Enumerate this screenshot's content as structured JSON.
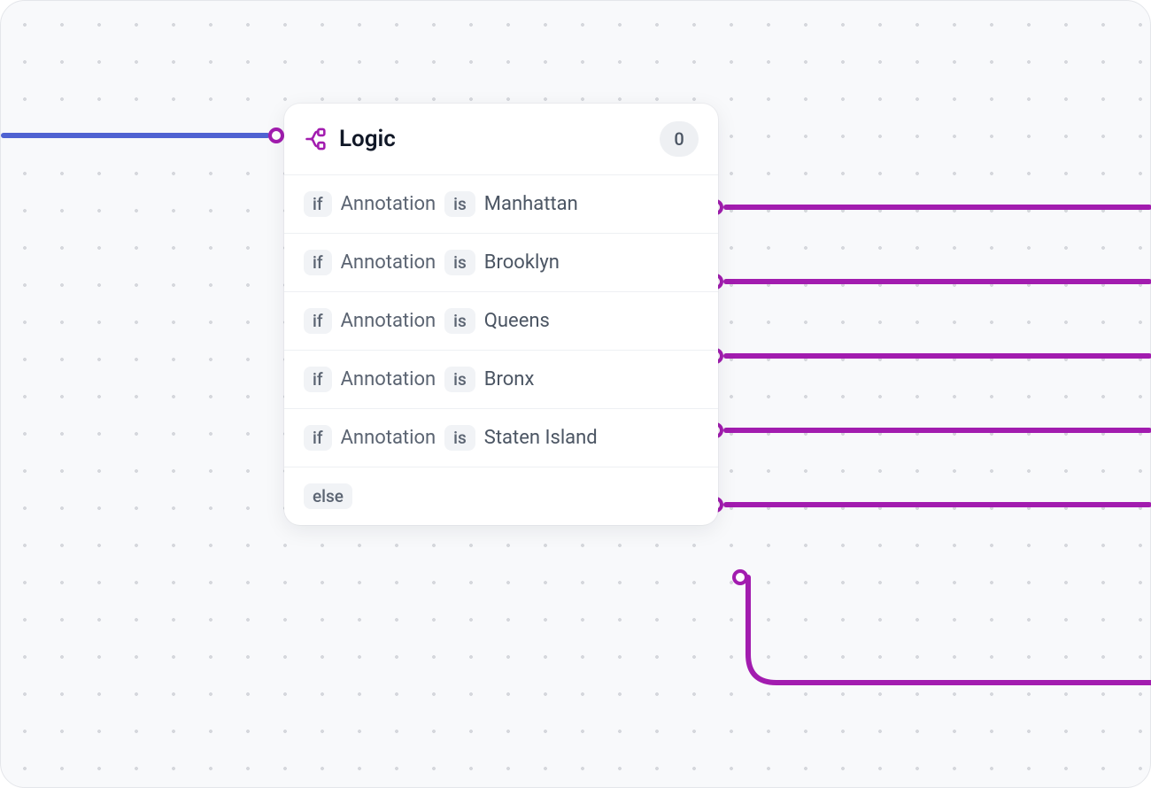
{
  "node": {
    "title": "Logic",
    "count": "0",
    "rules": [
      {
        "keyword": "if",
        "field": "Annotation",
        "op": "is",
        "value": "Manhattan"
      },
      {
        "keyword": "if",
        "field": "Annotation",
        "op": "is",
        "value": "Brooklyn"
      },
      {
        "keyword": "if",
        "field": "Annotation",
        "op": "is",
        "value": "Queens"
      },
      {
        "keyword": "if",
        "field": "Annotation",
        "op": "is",
        "value": "Bronx"
      },
      {
        "keyword": "if",
        "field": "Annotation",
        "op": "is",
        "value": "Staten Island"
      }
    ],
    "else_label": "else"
  },
  "colors": {
    "incoming_edge": "#4f63d2",
    "outgoing_edge": "#a21caf",
    "port_ring": "#a21caf"
  }
}
